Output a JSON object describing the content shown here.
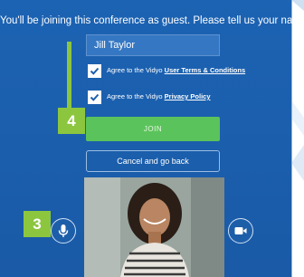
{
  "prompt_text": "You'll be joining this conference as guest. Please tell us your name:",
  "name_field": {
    "value": "Jill Taylor"
  },
  "terms_checkbox": {
    "prefix": "Agree to the Vidyo ",
    "link": "User Terms & Conditions",
    "checked": true
  },
  "privacy_checkbox": {
    "prefix": "Agree to the Vidyo ",
    "link": "Privacy Policy",
    "checked": true
  },
  "join_label": "JOIN",
  "cancel_label": "Cancel and go back",
  "callouts": {
    "join": "4",
    "mic": "3"
  },
  "icons": {
    "mic": "microphone-icon",
    "camera": "video-camera-icon",
    "check": "checkmark-icon"
  },
  "colors": {
    "dialog": "#1a5fae",
    "join": "#5bc35b",
    "callout": "#8cc63f"
  }
}
